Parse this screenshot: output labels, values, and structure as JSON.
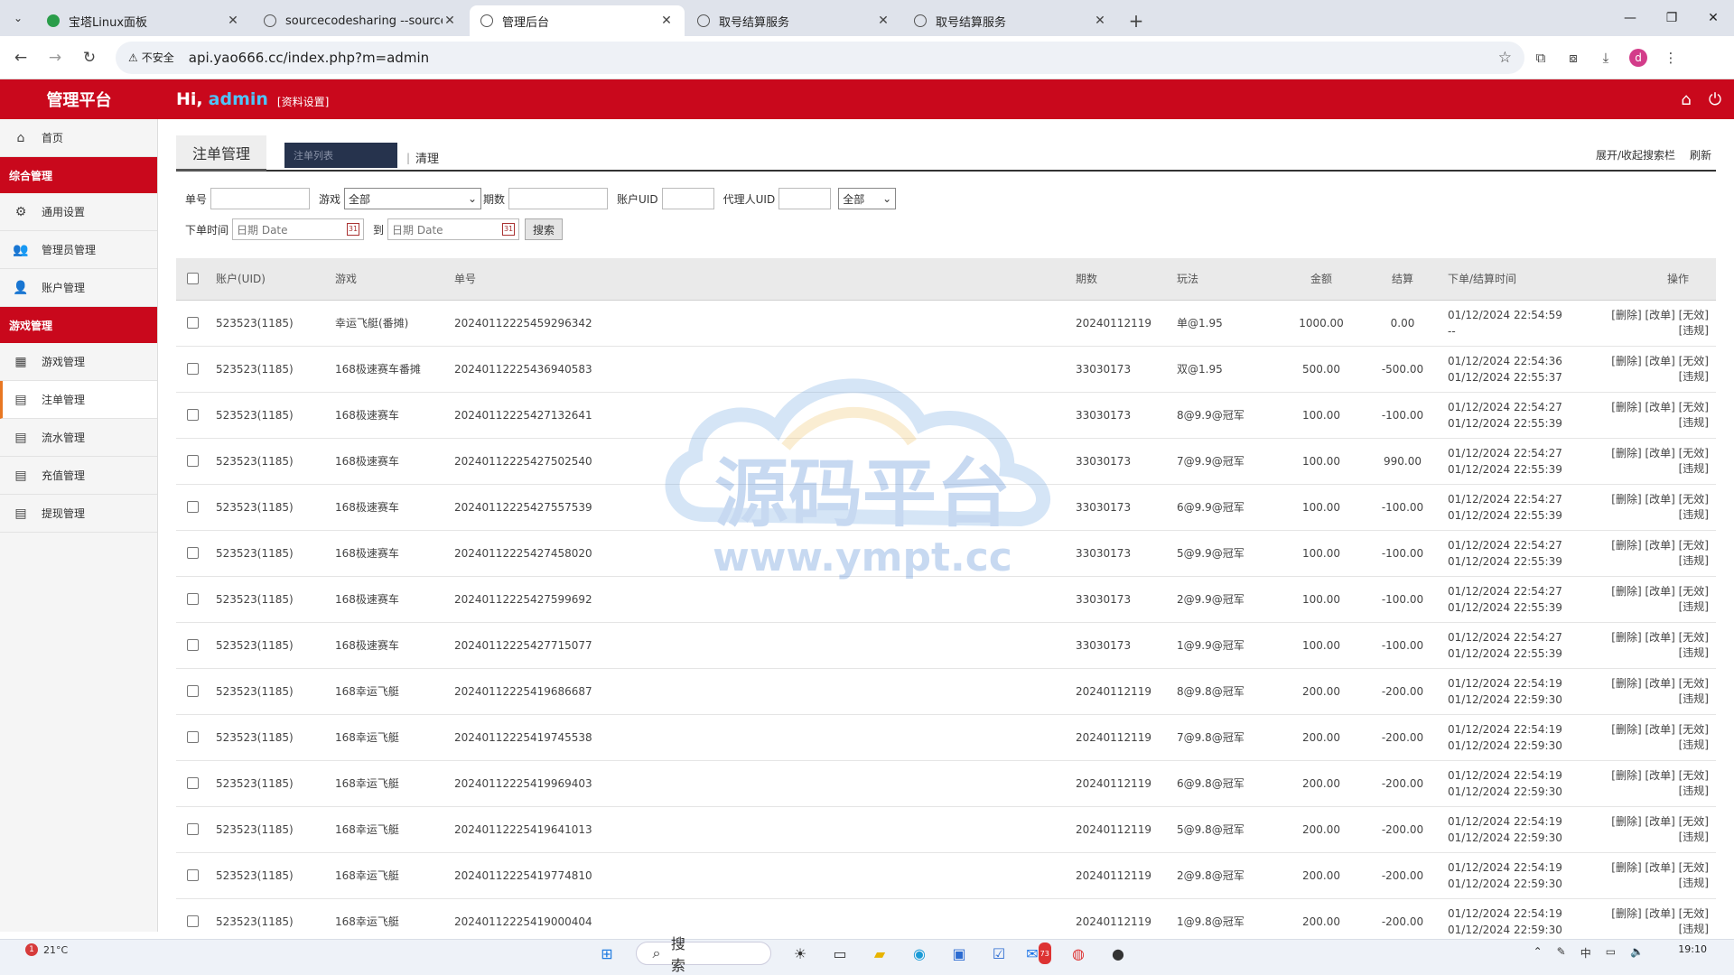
{
  "browser": {
    "tabs": [
      {
        "title": "宝塔Linux面板",
        "active": false
      },
      {
        "title": "sourcecodesharing --sourcec",
        "active": false
      },
      {
        "title": "管理后台",
        "active": true
      },
      {
        "title": "取号结算服务",
        "active": false
      },
      {
        "title": "取号结算服务",
        "active": false
      }
    ],
    "security_label": "不安全",
    "url": "api.yao666.cc/index.php?m=admin",
    "profile_initial": "d"
  },
  "header": {
    "brand": "管理平台",
    "greeting": "Hi,",
    "username": "admin",
    "profile_link": "[资料设置]"
  },
  "sidebar": {
    "home": "首页",
    "group1": "综合管理",
    "group1_items": [
      "通用设置",
      "管理员管理",
      "账户管理"
    ],
    "group2": "游戏管理",
    "group2_items": [
      "游戏管理",
      "注单管理",
      "流水管理",
      "充值管理",
      "提现管理"
    ]
  },
  "main": {
    "tab_title": "注单管理",
    "tab_list": "注单列表",
    "tab_clear": "清理",
    "toggle_search": "展开/收起搜索栏",
    "refresh": "刷新"
  },
  "filters": {
    "order_label": "单号",
    "game_label": "游戏",
    "game_value": "全部",
    "period_label": "期数",
    "uid_label": "账户UID",
    "agent_label": "代理人UID",
    "status_value": "全部",
    "time_label": "下单时间",
    "date_placeholder": "日期 Date",
    "to_label": "到",
    "search_button": "搜索"
  },
  "table": {
    "headers": [
      "账户(UID)",
      "游戏",
      "单号",
      "期数",
      "玩法",
      "金额",
      "结算",
      "下单/结算时间",
      "操作"
    ],
    "ops_line1": "[删除] [改单] [无效]",
    "ops_line2": "[违规]",
    "rows": [
      {
        "uid": "523523(1185)",
        "game": "幸运飞艇(番摊)",
        "order": "20240112225459296342",
        "period": "20240112119",
        "play": "单@1.95",
        "amount": "1000.00",
        "settle": "0.00",
        "t1": "01/12/2024 22:54:59",
        "t2": "--"
      },
      {
        "uid": "523523(1185)",
        "game": "168极速赛车番摊",
        "order": "20240112225436940583",
        "period": "33030173",
        "play": "双@1.95",
        "amount": "500.00",
        "settle": "-500.00",
        "t1": "01/12/2024 22:54:36",
        "t2": "01/12/2024 22:55:37"
      },
      {
        "uid": "523523(1185)",
        "game": "168极速赛车",
        "order": "20240112225427132641",
        "period": "33030173",
        "play": "8@9.9@冠军",
        "amount": "100.00",
        "settle": "-100.00",
        "t1": "01/12/2024 22:54:27",
        "t2": "01/12/2024 22:55:39"
      },
      {
        "uid": "523523(1185)",
        "game": "168极速赛车",
        "order": "20240112225427502540",
        "period": "33030173",
        "play": "7@9.9@冠军",
        "amount": "100.00",
        "settle": "990.00",
        "t1": "01/12/2024 22:54:27",
        "t2": "01/12/2024 22:55:39"
      },
      {
        "uid": "523523(1185)",
        "game": "168极速赛车",
        "order": "20240112225427557539",
        "period": "33030173",
        "play": "6@9.9@冠军",
        "amount": "100.00",
        "settle": "-100.00",
        "t1": "01/12/2024 22:54:27",
        "t2": "01/12/2024 22:55:39"
      },
      {
        "uid": "523523(1185)",
        "game": "168极速赛车",
        "order": "20240112225427458020",
        "period": "33030173",
        "play": "5@9.9@冠军",
        "amount": "100.00",
        "settle": "-100.00",
        "t1": "01/12/2024 22:54:27",
        "t2": "01/12/2024 22:55:39"
      },
      {
        "uid": "523523(1185)",
        "game": "168极速赛车",
        "order": "20240112225427599692",
        "period": "33030173",
        "play": "2@9.9@冠军",
        "amount": "100.00",
        "settle": "-100.00",
        "t1": "01/12/2024 22:54:27",
        "t2": "01/12/2024 22:55:39"
      },
      {
        "uid": "523523(1185)",
        "game": "168极速赛车",
        "order": "20240112225427715077",
        "period": "33030173",
        "play": "1@9.9@冠军",
        "amount": "100.00",
        "settle": "-100.00",
        "t1": "01/12/2024 22:54:27",
        "t2": "01/12/2024 22:55:39"
      },
      {
        "uid": "523523(1185)",
        "game": "168幸运飞艇",
        "order": "20240112225419686687",
        "period": "20240112119",
        "play": "8@9.8@冠军",
        "amount": "200.00",
        "settle": "-200.00",
        "t1": "01/12/2024 22:54:19",
        "t2": "01/12/2024 22:59:30"
      },
      {
        "uid": "523523(1185)",
        "game": "168幸运飞艇",
        "order": "20240112225419745538",
        "period": "20240112119",
        "play": "7@9.8@冠军",
        "amount": "200.00",
        "settle": "-200.00",
        "t1": "01/12/2024 22:54:19",
        "t2": "01/12/2024 22:59:30"
      },
      {
        "uid": "523523(1185)",
        "game": "168幸运飞艇",
        "order": "20240112225419969403",
        "period": "20240112119",
        "play": "6@9.8@冠军",
        "amount": "200.00",
        "settle": "-200.00",
        "t1": "01/12/2024 22:54:19",
        "t2": "01/12/2024 22:59:30"
      },
      {
        "uid": "523523(1185)",
        "game": "168幸运飞艇",
        "order": "20240112225419641013",
        "period": "20240112119",
        "play": "5@9.8@冠军",
        "amount": "200.00",
        "settle": "-200.00",
        "t1": "01/12/2024 22:54:19",
        "t2": "01/12/2024 22:59:30"
      },
      {
        "uid": "523523(1185)",
        "game": "168幸运飞艇",
        "order": "20240112225419774810",
        "period": "20240112119",
        "play": "2@9.8@冠军",
        "amount": "200.00",
        "settle": "-200.00",
        "t1": "01/12/2024 22:54:19",
        "t2": "01/12/2024 22:59:30"
      },
      {
        "uid": "523523(1185)",
        "game": "168幸运飞艇",
        "order": "20240112225419000404",
        "period": "20240112119",
        "play": "1@9.8@冠军",
        "amount": "200.00",
        "settle": "-200.00",
        "t1": "01/12/2024 22:54:19",
        "t2": "01/12/2024 22:59:30"
      }
    ]
  },
  "watermark": {
    "text": "源码平台",
    "url": "www.ympt.cc"
  },
  "taskbar": {
    "temperature": "21°C",
    "weather_badge": "1",
    "search_placeholder": "搜索",
    "ime": "中",
    "time": "19:10",
    "mail_badge": "73"
  },
  "colors": {
    "brand_red": "#c9081c",
    "username_blue": "#4fc3f7",
    "active_tab_marker": "#e87722"
  }
}
